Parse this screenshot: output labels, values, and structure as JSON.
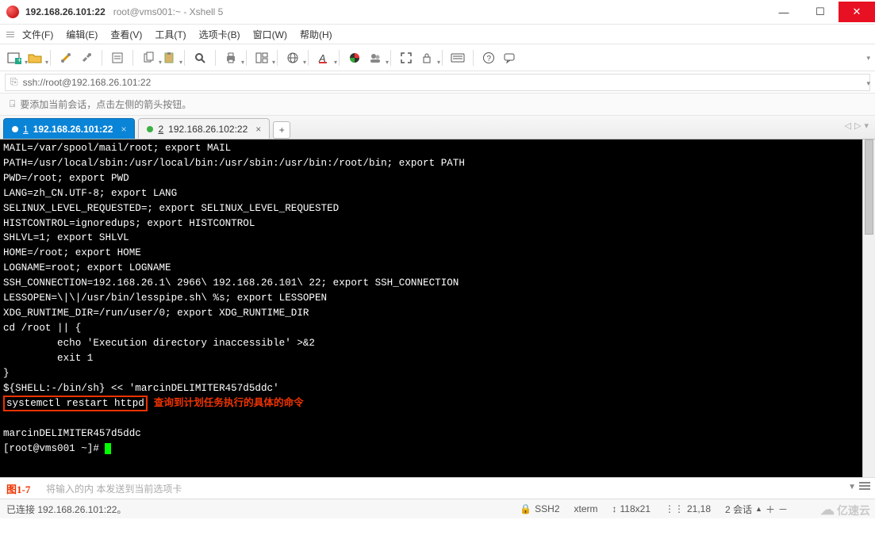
{
  "title": {
    "host": "192.168.26.101:22",
    "rest": "root@vms001:~ - Xshell 5"
  },
  "menu": [
    "文件(F)",
    "编辑(E)",
    "查看(V)",
    "工具(T)",
    "选项卡(B)",
    "窗口(W)",
    "帮助(H)"
  ],
  "address": {
    "url": "ssh://root@192.168.26.101:22"
  },
  "hint": "要添加当前会话，点击左侧的箭头按钮。",
  "tabs": {
    "items": [
      {
        "num": "1",
        "label": "192.168.26.101:22",
        "active": true
      },
      {
        "num": "2",
        "label": "192.168.26.102:22",
        "active": false
      }
    ],
    "add_label": "+"
  },
  "terminal": {
    "lines": [
      "MAIL=/var/spool/mail/root; export MAIL",
      "PATH=/usr/local/sbin:/usr/local/bin:/usr/sbin:/usr/bin:/root/bin; export PATH",
      "PWD=/root; export PWD",
      "LANG=zh_CN.UTF-8; export LANG",
      "SELINUX_LEVEL_REQUESTED=; export SELINUX_LEVEL_REQUESTED",
      "HISTCONTROL=ignoredups; export HISTCONTROL",
      "SHLVL=1; export SHLVL",
      "HOME=/root; export HOME",
      "LOGNAME=root; export LOGNAME",
      "SSH_CONNECTION=192.168.26.1\\ 2966\\ 192.168.26.101\\ 22; export SSH_CONNECTION",
      "LESSOPEN=\\|\\|/usr/bin/lesspipe.sh\\ %s; export LESSOPEN",
      "XDG_RUNTIME_DIR=/run/user/0; export XDG_RUNTIME_DIR",
      "cd /root || {",
      "         echo 'Execution directory inaccessible' >&2",
      "         exit 1",
      "}",
      "${SHELL:-/bin/sh} << 'marcinDELIMITER457d5ddc'"
    ],
    "highlight_cmd": "systemctl restart httpd",
    "highlight_note": "查询到计划任务执行的具体的命令",
    "post_lines": [
      "",
      "marcinDELIMITER457d5ddc"
    ],
    "prompt": "[root@vms001 ~]# "
  },
  "figure_label": "图1-7",
  "input_placeholder": "   本发送到当前选项卡",
  "status": {
    "left": "已连接  192.168.26.101:22。",
    "proto": "SSH2",
    "term": "xterm",
    "size": "118x21",
    "pos": "21,18",
    "sessions_label": "2 会话",
    "brand": "亿速云"
  }
}
